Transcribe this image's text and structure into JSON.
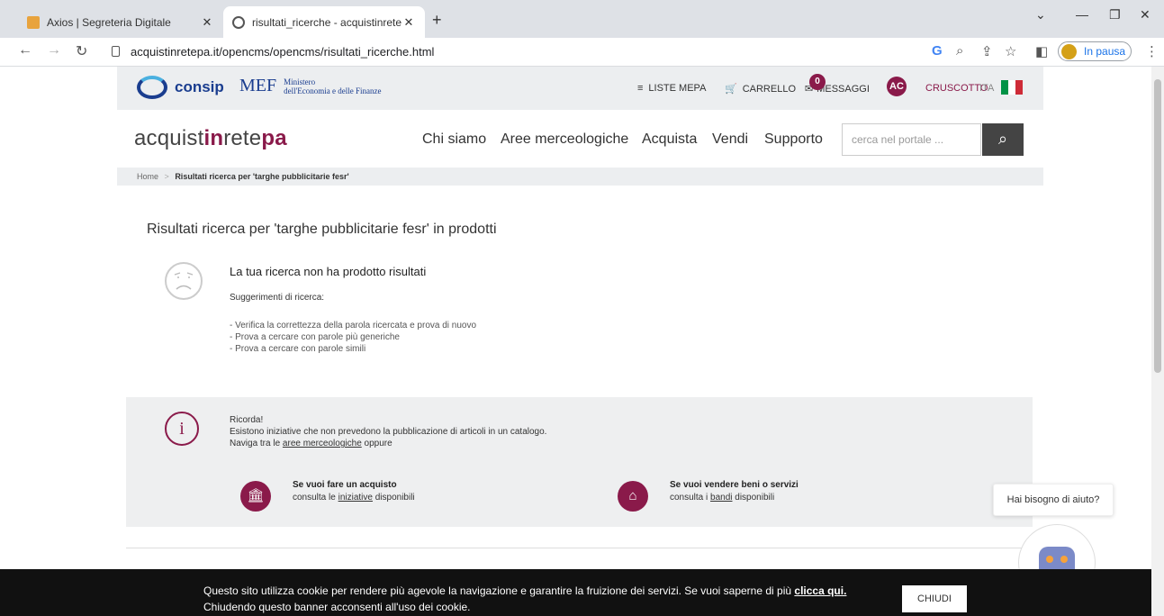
{
  "browser": {
    "tabs": [
      {
        "title": "Axios | Segreteria Digitale",
        "active": false
      },
      {
        "title": "risultati_ricerche - acquistinretepa",
        "active": true
      }
    ],
    "url": "acquistinretepa.it/opencms/opencms/risultati_ricerche.html",
    "profile_status": "In pausa"
  },
  "topbar": {
    "consip": "consip",
    "mef": "MEF",
    "mef_line1": "Ministero",
    "mef_line2": "dell'Economia e delle Finanze",
    "liste_mepa": "LISTE MEPA",
    "carrello": "CARRELLO",
    "messaggi": "MESSAGGI",
    "messaggi_count": "0",
    "avatar": "AC",
    "cruscotto": "CRUSCOTTO",
    "lang": "ITA"
  },
  "nav": {
    "brand_a": "acquist",
    "brand_b": "in",
    "brand_c": "rete",
    "brand_d": "pa",
    "items": [
      "Chi siamo",
      "Aree merceologiche",
      "Acquista",
      "Vendi",
      "Supporto"
    ],
    "search_placeholder": "cerca nel portale ..."
  },
  "breadcrumb": {
    "home": "Home",
    "sep": ">",
    "current": "Risultati ricerca per 'targhe pubblicitarie fesr'"
  },
  "results": {
    "title": "Risultati ricerca per 'targhe pubblicitarie fesr' in prodotti",
    "no_results": "La tua ricerca non ha prodotto risultati",
    "suggestions_title": "Suggerimenti di ricerca:",
    "suggestions": [
      "- Verifica la correttezza della parola ricercata e prova di nuovo",
      "- Prova a cercare con parole più generiche",
      "- Prova a cercare con parole simili"
    ]
  },
  "remind": {
    "title": "Ricorda!",
    "line1": "Esistono iniziative che non prevedono la pubblicazione di articoli in un catalogo.",
    "line2_a": "Naviga tra le ",
    "line2_link": "aree merceologiche",
    "line2_b": " oppure",
    "buy_title": "Se vuoi fare un acquisto",
    "buy_a": "consulta le ",
    "buy_link": "iniziative",
    "buy_b": " disponibili",
    "sell_title": "Se vuoi vendere beni o servizi",
    "sell_a": "consulta i ",
    "sell_link": "bandi",
    "sell_b": " disponibili"
  },
  "help": {
    "bubble": "Hai bisogno di aiuto?"
  },
  "cookie": {
    "line1": "Questo sito utilizza cookie per rendere più agevole la navigazione e garantire la fruizione dei servizi. Se vuoi saperne di più ",
    "link": "clicca qui.",
    "line2": "Chiudendo questo banner acconsenti all'uso dei cookie.",
    "close": "CHIUDI"
  },
  "colors": {
    "accent": "#8a1a4a",
    "consip_blue": "#1a3d8f"
  }
}
